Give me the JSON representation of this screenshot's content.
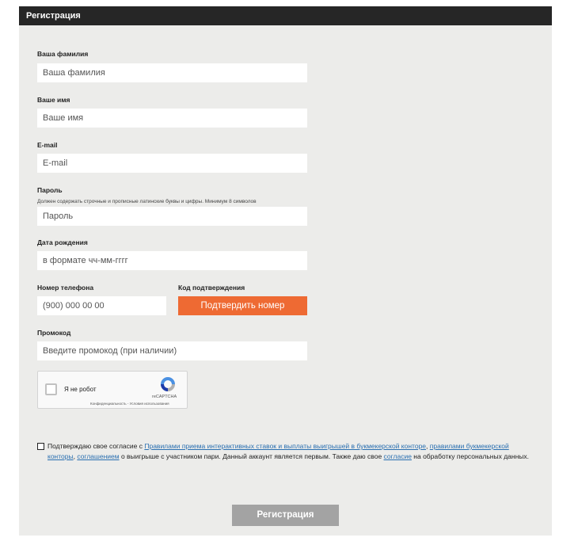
{
  "form": {
    "title": "Регистрация",
    "surname": {
      "label": "Ваша фамилия",
      "placeholder": "Ваша фамилия"
    },
    "name": {
      "label": "Ваше имя",
      "placeholder": "Ваше имя"
    },
    "email": {
      "label": "E-mail",
      "placeholder": "E-mail"
    },
    "password": {
      "label": "Пароль",
      "hint": "Должен содержать строчные и прописные латинские буквы и цифры. Минимум 8 символов",
      "placeholder": "Пароль"
    },
    "birthdate": {
      "label": "Дата рождения",
      "placeholder": "в формате чч-мм-гггг"
    },
    "phone": {
      "label": "Номер телефона",
      "placeholder": "(900) 000 00 00"
    },
    "code": {
      "label": "Код подтверждения",
      "button": "Подтвердить номер"
    },
    "promo": {
      "label": "Промокод",
      "placeholder": "Введите промокод (при наличии)"
    },
    "recaptcha": {
      "label": "Я не робот",
      "brand": "reCAPTCHA",
      "terms": "Конфиденциальность - Условия использования"
    },
    "consent": {
      "t1": "Подтверждаю свое согласие с ",
      "link1": "Правилами приема интерактивных ставок и выплаты выигрышей в букмекерской конторе",
      "t2": ", ",
      "link2": "правилами букмекерской конторы",
      "t3": ", ",
      "link3": "соглашением",
      "t4": " о выигрыше с участником пари. Данный аккаунт является первым. Также даю свое ",
      "link4": "согласие",
      "t5": " на обработку персональных данных."
    },
    "submit": "Регистрация"
  },
  "colors": {
    "header_bg": "#262626",
    "panel_bg": "#ececea",
    "accent": "#ee6a33",
    "submit_disabled": "#a3a3a3",
    "link": "#2a6fb0"
  }
}
